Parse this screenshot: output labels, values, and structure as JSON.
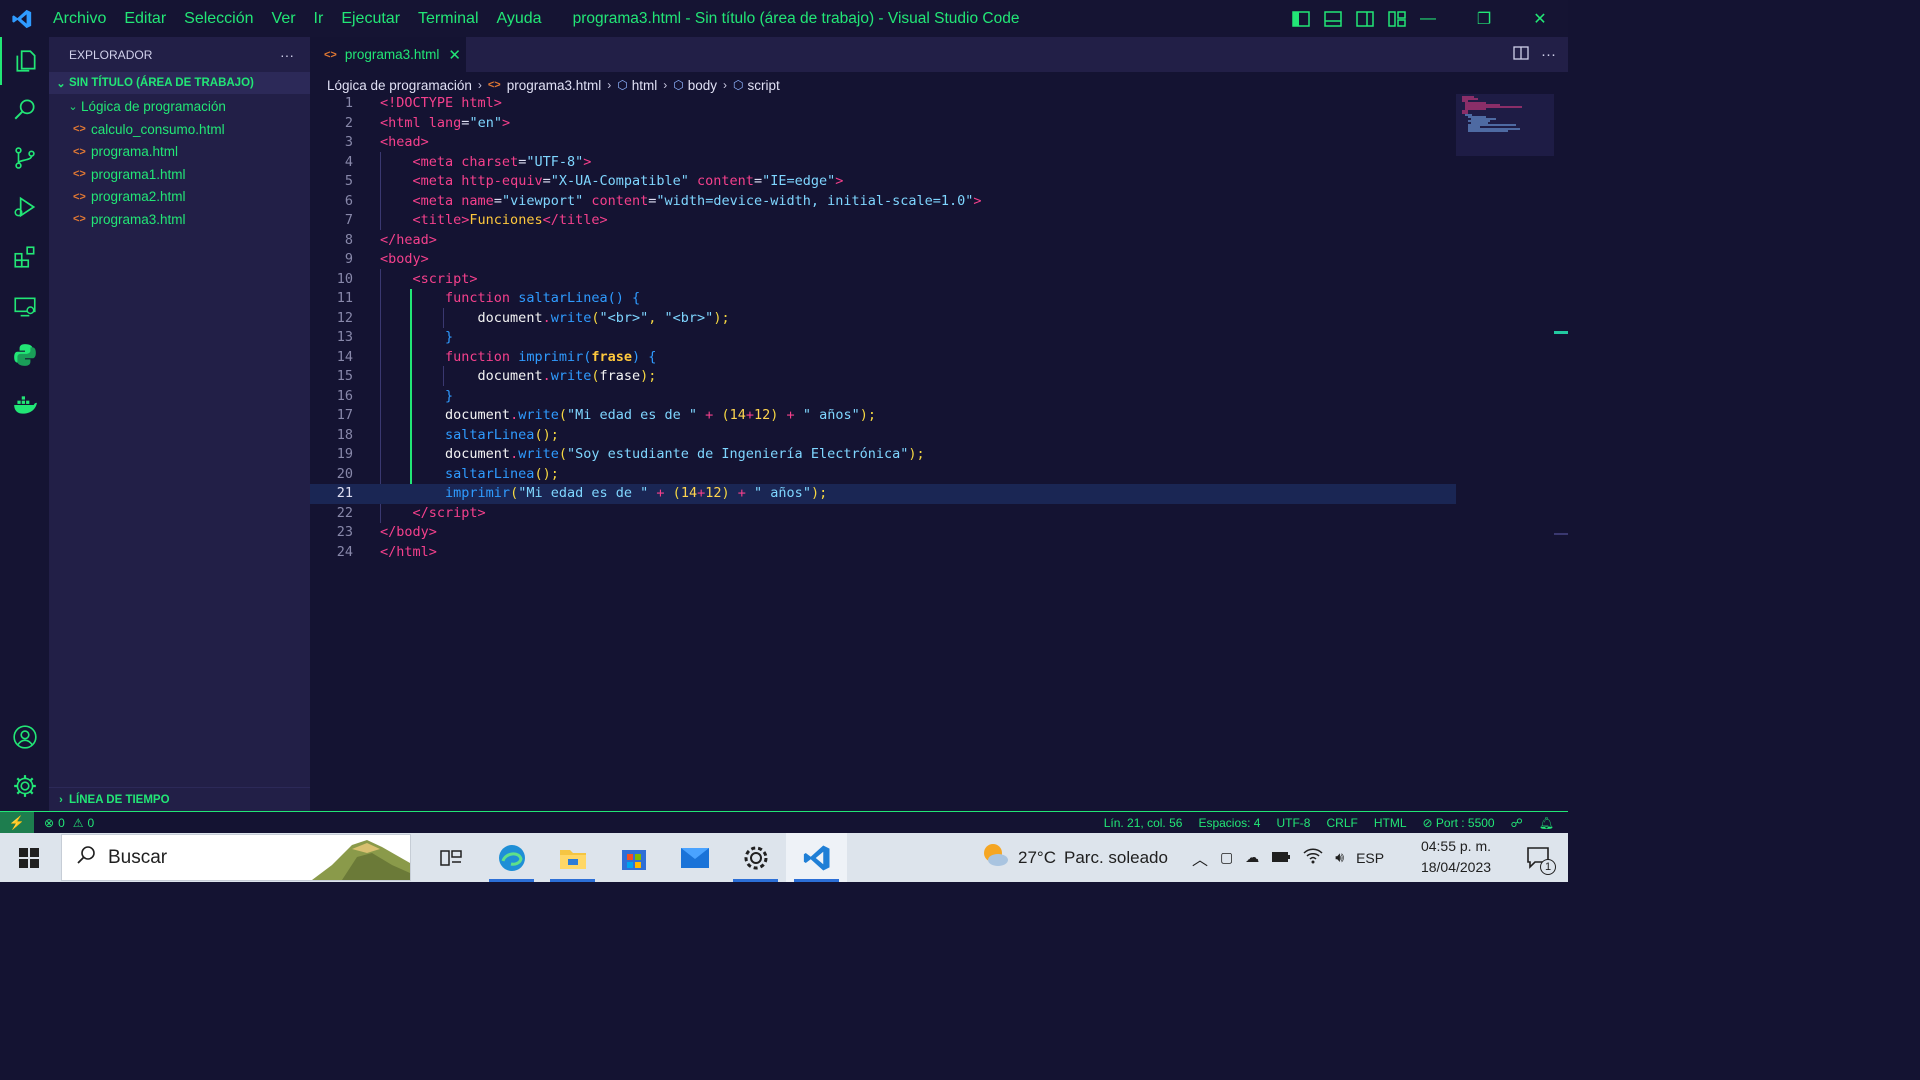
{
  "titlebar": {
    "menu": [
      "Archivo",
      "Editar",
      "Selección",
      "Ver",
      "Ir",
      "Ejecutar",
      "Terminal",
      "Ayuda"
    ],
    "title": "programa3.html - Sin título (área de trabajo) - Visual Studio Code"
  },
  "activitybar": [
    "explorer-icon",
    "search-icon",
    "source-control-icon",
    "run-debug-icon",
    "extensions-icon",
    "remote-explorer-icon",
    "python-icon",
    "docker-icon",
    "accounts-icon",
    "settings-gear-icon"
  ],
  "sidebar": {
    "header": "EXPLORADOR",
    "more": "···",
    "workspace": "SIN TÍTULO (ÁREA DE TRABAJO)",
    "folder": "Lógica de programación",
    "files": [
      "calculo_consumo.html",
      "programa.html",
      "programa1.html",
      "programa2.html",
      "programa3.html"
    ],
    "timeline": "LÍNEA DE TIEMPO"
  },
  "tab": {
    "label": "programa3.html",
    "close": "✕"
  },
  "breadcrumb": {
    "folder": "Lógica de programación",
    "file": "programa3.html",
    "s1": "html",
    "s2": "body",
    "s3": "script"
  },
  "editor": {
    "current_line": 21,
    "line_numbers": [
      "1",
      "2",
      "3",
      "4",
      "5",
      "6",
      "7",
      "8",
      "9",
      "10",
      "11",
      "12",
      "13",
      "14",
      "15",
      "16",
      "17",
      "18",
      "19",
      "20",
      "21",
      "22",
      "23",
      "24"
    ],
    "code": {
      "doctype": "<!DOCTYPE html>",
      "html_lang": "\"en\"",
      "charset": "\"UTF-8\"",
      "http_equiv": "\"X-UA-Compatible\"",
      "ie_edge": "\"IE=edge\"",
      "viewport": "\"viewport\"",
      "viewport_content": "\"width=device-width, initial-scale=1.0\"",
      "title_text": "Funciones",
      "fn1": "saltarLinea",
      "br_str": "\"<br>\"",
      "fn2": "imprimir",
      "param": "frase",
      "str_edad": "\"Mi edad es de \"",
      "n1": "14",
      "n2": "12",
      "str_anios": "\" años\"",
      "str_estudiante": "\"Soy estudiante de Ingeniería Electrónica\""
    }
  },
  "statusbar": {
    "errors": "0",
    "warnings": "0",
    "position": "Lín. 21, col. 56",
    "spaces": "Espacios: 4",
    "encoding": "UTF-8",
    "eol": "CRLF",
    "language": "HTML",
    "port": "Port : 5500"
  },
  "taskbar": {
    "search": "Buscar",
    "weather_temp": "27°C",
    "weather_desc": "Parc. soleado",
    "lang": "ESP",
    "time": "04:55 p. m.",
    "date": "18/04/2023",
    "notifications": "1"
  },
  "colors": {
    "accent": "#22e676",
    "background": "#141332",
    "sidebar": "#221f47",
    "tag": "#f5408c",
    "function": "#2f9bff",
    "string": "#7fd6ff"
  }
}
